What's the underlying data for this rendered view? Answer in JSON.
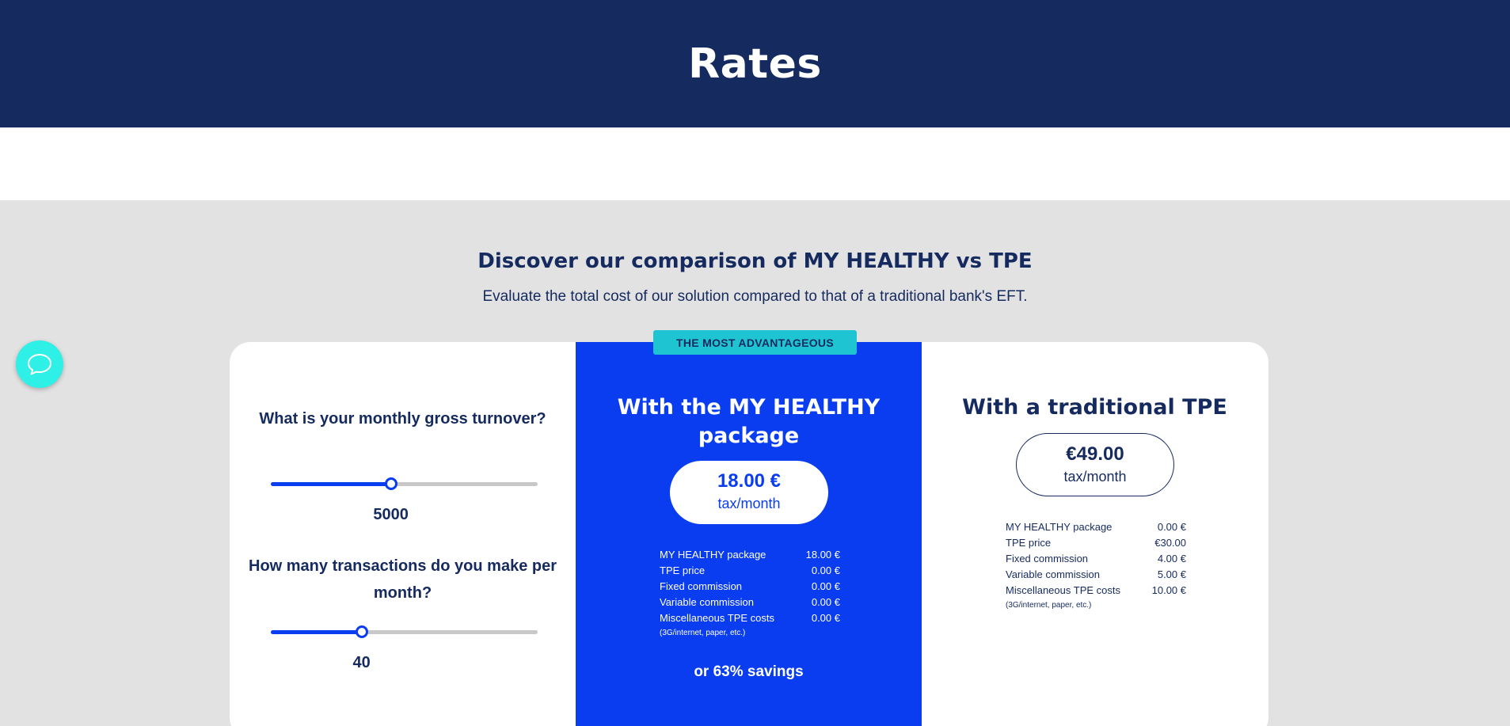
{
  "header": {
    "title": "Rates"
  },
  "comparison": {
    "title": "Discover our comparison of MY HEALTHY vs TPE",
    "subtitle": "Evaluate the total cost of our solution compared to that of a traditional bank's EFT."
  },
  "chat": {
    "icon": "chat-icon"
  },
  "calculator": {
    "turnover_question": "What is your monthly gross turnover?",
    "turnover_value": "5000",
    "turnover_fraction": 0.45,
    "transactions_question": "How many transactions do you make per month?",
    "transactions_value": "40",
    "transactions_fraction": 0.34
  },
  "my_healthy": {
    "badge": "THE MOST ADVANTAGEOUS",
    "title": "With the MY HEALTHY package",
    "price": "18.00 €",
    "price_unit": "tax/month",
    "rows": [
      {
        "label": "MY HEALTHY package",
        "value": "18.00 €"
      },
      {
        "label": "TPE price",
        "value": "0.00 €"
      },
      {
        "label": "Fixed commission",
        "value": "0.00 €"
      },
      {
        "label": "Variable commission",
        "value": "0.00 €"
      },
      {
        "label": "Miscellaneous TPE costs",
        "value": "0.00 €"
      }
    ],
    "note": "(3G/internet, paper, etc.)",
    "savings": "or 63% savings"
  },
  "traditional": {
    "title": "With a traditional TPE",
    "price": "€49.00",
    "price_unit": "tax/month",
    "rows": [
      {
        "label": "MY HEALTHY package",
        "value": "0.00 €"
      },
      {
        "label": "TPE price",
        "value": "€30.00"
      },
      {
        "label": "Fixed commission",
        "value": "4.00 €"
      },
      {
        "label": "Variable commission",
        "value": "5.00 €"
      },
      {
        "label": "Miscellaneous TPE costs",
        "value": "10.00 €"
      }
    ],
    "note": "(3G/internet, paper, etc.)"
  },
  "colors": {
    "navy": "#152a5e",
    "brand_blue": "#0a3df0",
    "badge_teal": "#1fc4d3",
    "chat_cyan": "#2ef0e6"
  }
}
